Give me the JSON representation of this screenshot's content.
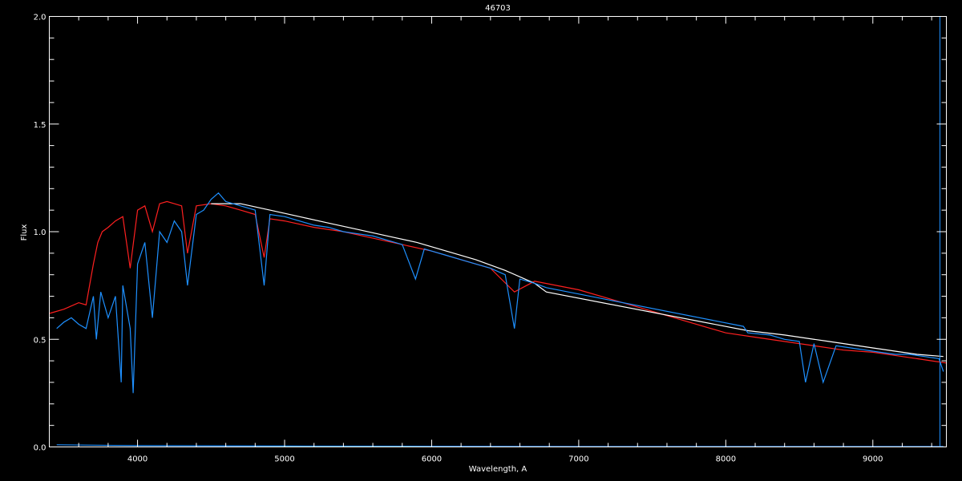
{
  "chart_data": {
    "type": "line",
    "title": "46703",
    "xlabel": "Wavelength, A",
    "ylabel": "Flux",
    "xlim": [
      3400,
      9500
    ],
    "ylim": [
      0.0,
      2.0
    ],
    "x_ticks": [
      4000,
      5000,
      6000,
      7000,
      8000,
      9000
    ],
    "y_ticks": [
      0.0,
      0.5,
      1.0,
      1.5,
      2.0
    ],
    "x_tick_labels": [
      "4000",
      "5000",
      "6000",
      "7000",
      "8000",
      "9000"
    ],
    "y_tick_labels": [
      "0.0",
      "0.5",
      "1.0",
      "1.5",
      "2.0"
    ],
    "grid": false,
    "colors": {
      "background": "#000000",
      "observed": "#ffffff",
      "model": "#ff2020",
      "corrected": "#1e90ff"
    },
    "series": [
      {
        "color": "#ff2020",
        "x": [
          3400,
          3500,
          3600,
          3650,
          3700,
          3730,
          3760,
          3800,
          3850,
          3900,
          3950,
          4000,
          4050,
          4101,
          4150,
          4200,
          4250,
          4300,
          4340,
          4400,
          4500,
          4600,
          4700,
          4800,
          4861,
          4900,
          5000,
          5200,
          5400,
          5600,
          5800,
          6000,
          6200,
          6400,
          6563,
          6700,
          7000,
          7500,
          8000,
          8200,
          8500,
          8800,
          9000,
          9200,
          9400,
          9500
        ],
        "y": [
          0.62,
          0.64,
          0.67,
          0.66,
          0.85,
          0.95,
          1.0,
          1.02,
          1.05,
          1.07,
          0.83,
          1.1,
          1.12,
          1.0,
          1.13,
          1.14,
          1.13,
          1.12,
          0.9,
          1.12,
          1.13,
          1.12,
          1.1,
          1.08,
          0.88,
          1.06,
          1.05,
          1.02,
          1.0,
          0.97,
          0.94,
          0.91,
          0.87,
          0.83,
          0.72,
          0.77,
          0.73,
          0.63,
          0.53,
          0.51,
          0.48,
          0.45,
          0.44,
          0.42,
          0.4,
          0.39
        ]
      },
      {
        "color": "#ffffff",
        "x": [
          4500,
          4700,
          4900,
          5100,
          5300,
          5500,
          5700,
          5900,
          6100,
          6300,
          6500,
          6700,
          6780,
          8150,
          8400,
          8700,
          9000,
          9300,
          9480
        ],
        "y": [
          1.13,
          1.13,
          1.1,
          1.07,
          1.04,
          1.01,
          0.98,
          0.95,
          0.91,
          0.87,
          0.82,
          0.76,
          0.72,
          0.54,
          0.52,
          0.49,
          0.46,
          0.43,
          0.42
        ]
      },
      {
        "color": "#1e90ff",
        "x": [
          3450,
          3500,
          3550,
          3600,
          3650,
          3700,
          3720,
          3750,
          3800,
          3850,
          3889,
          3900,
          3950,
          3970,
          4000,
          4050,
          4101,
          4150,
          4200,
          4250,
          4300,
          4340,
          4400,
          4450,
          4500,
          4550,
          4600,
          4700,
          4800,
          4861,
          4900,
          5000,
          5100,
          5200,
          5300,
          5400,
          5500,
          5600,
          5700,
          5800,
          5890,
          5950,
          6000,
          6100,
          6200,
          6300,
          6400,
          6500,
          6563,
          6600,
          6700,
          6780,
          8120,
          8150,
          8300,
          8400,
          8500,
          8542,
          8600,
          8662,
          8750,
          8850,
          8950,
          9050,
          9150,
          9250,
          9350,
          9450,
          9480
        ],
        "y": [
          0.55,
          0.58,
          0.6,
          0.57,
          0.55,
          0.7,
          0.5,
          0.72,
          0.6,
          0.7,
          0.3,
          0.75,
          0.55,
          0.25,
          0.85,
          0.95,
          0.6,
          1.0,
          0.95,
          1.05,
          1.0,
          0.75,
          1.08,
          1.1,
          1.15,
          1.18,
          1.14,
          1.12,
          1.1,
          0.75,
          1.08,
          1.07,
          1.05,
          1.03,
          1.02,
          1.0,
          0.99,
          0.98,
          0.96,
          0.94,
          0.78,
          0.92,
          0.91,
          0.89,
          0.87,
          0.85,
          0.83,
          0.8,
          0.55,
          0.78,
          0.76,
          0.74,
          0.56,
          0.53,
          0.52,
          0.5,
          0.49,
          0.3,
          0.48,
          0.3,
          0.47,
          0.46,
          0.45,
          0.44,
          0.43,
          0.43,
          0.42,
          0.41,
          0.35
        ]
      },
      {
        "color": "#1e90ff",
        "x": [
          3450,
          4000,
          5000,
          6000,
          7000,
          8000,
          9000,
          9480
        ],
        "y": [
          0.01,
          0.006,
          0.004,
          0.003,
          0.002,
          0.002,
          0.002,
          0.002
        ]
      }
    ]
  }
}
